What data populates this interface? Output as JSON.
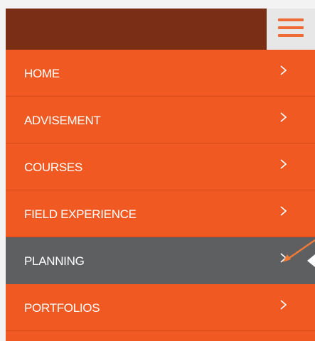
{
  "colors": {
    "menu_bg": "#f05a22",
    "header_bg": "#7a2e16",
    "active_bg": "#5e5f61",
    "hamburger_bg": "#e7e7e7",
    "hamburger_lines": "#ee6b35",
    "annotation_arrow": "#f07a36"
  },
  "header": {
    "menu_toggle_icon": "hamburger-icon"
  },
  "menu": {
    "items": [
      {
        "label": "HOME",
        "active": false
      },
      {
        "label": "ADVISEMENT",
        "active": false
      },
      {
        "label": "COURSES",
        "active": false
      },
      {
        "label": "FIELD EXPERIENCE",
        "active": false
      },
      {
        "label": "PLANNING",
        "active": true
      },
      {
        "label": "PORTFOLIOS",
        "active": false
      }
    ],
    "chevron_icon": "chevron-right-icon"
  }
}
